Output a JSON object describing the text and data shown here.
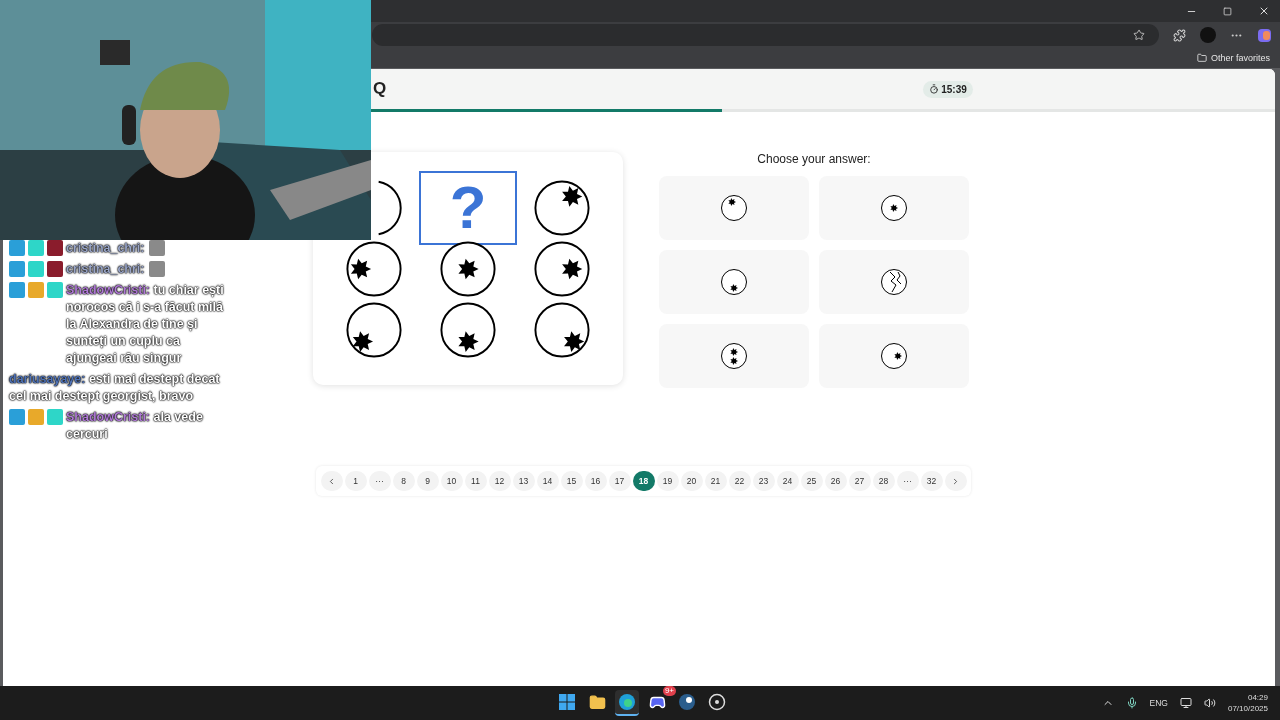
{
  "browser": {
    "bookmark": "Other favorites"
  },
  "header": {
    "title": "Q",
    "timer": "15:39",
    "progress": {
      "level": 0.565
    }
  },
  "puzzle": {
    "cells": [
      {
        "kind": "covered"
      },
      {
        "kind": "question",
        "label": "?"
      },
      {
        "kind": "northeast"
      },
      {
        "kind": "west"
      },
      {
        "kind": "center"
      },
      {
        "kind": "east"
      },
      {
        "kind": "southwest"
      },
      {
        "kind": "south"
      },
      {
        "kind": "southeast"
      }
    ]
  },
  "answers": {
    "prompt": "Choose your answer:",
    "options": [
      {
        "kind": "north",
        "selected": false
      },
      {
        "kind": "center",
        "selected": false
      },
      {
        "kind": "south",
        "selected": false
      },
      {
        "kind": "cracked",
        "selected": false
      },
      {
        "kind": "double",
        "selected": false
      },
      {
        "kind": "east",
        "selected": false
      }
    ]
  },
  "pagination": [
    {
      "kind": "prev",
      "selected": false
    },
    {
      "kind": "page",
      "label": "1",
      "selected": false
    },
    {
      "kind": "ellipsis",
      "label": "···",
      "selected": false
    },
    {
      "kind": "page",
      "label": "8",
      "selected": false
    },
    {
      "kind": "page",
      "label": "9",
      "selected": false
    },
    {
      "kind": "page",
      "label": "10",
      "selected": false
    },
    {
      "kind": "page",
      "label": "11",
      "selected": false
    },
    {
      "kind": "page",
      "label": "12",
      "selected": false
    },
    {
      "kind": "page",
      "label": "13",
      "selected": false
    },
    {
      "kind": "page",
      "label": "14",
      "selected": false
    },
    {
      "kind": "page",
      "label": "15",
      "selected": false
    },
    {
      "kind": "page",
      "label": "16",
      "selected": false
    },
    {
      "kind": "page",
      "label": "17",
      "selected": false
    },
    {
      "kind": "page",
      "label": "18",
      "selected": true
    },
    {
      "kind": "page",
      "label": "19",
      "selected": false
    },
    {
      "kind": "page",
      "label": "20",
      "selected": false
    },
    {
      "kind": "page",
      "label": "21",
      "selected": false
    },
    {
      "kind": "page",
      "label": "22",
      "selected": false
    },
    {
      "kind": "page",
      "label": "23",
      "selected": false
    },
    {
      "kind": "page",
      "label": "24",
      "selected": false
    },
    {
      "kind": "page",
      "label": "25",
      "selected": false
    },
    {
      "kind": "page",
      "label": "26",
      "selected": false
    },
    {
      "kind": "page",
      "label": "27",
      "selected": false
    },
    {
      "kind": "page",
      "label": "28",
      "selected": false
    },
    {
      "kind": "ellipsis",
      "label": "···",
      "selected": false
    },
    {
      "kind": "page",
      "label": "32",
      "selected": false
    },
    {
      "kind": "next",
      "selected": false
    }
  ],
  "chat": [
    {
      "badges": [
        {
          "kind": "tool"
        },
        {
          "kind": "tag"
        },
        {
          "kind": "demon"
        }
      ],
      "name": "cristina_chri:",
      "color": "#9aa6c8",
      "trailing_badges": [
        {
          "kind": "avatar"
        }
      ]
    },
    {
      "badges": [
        {
          "kind": "tool"
        },
        {
          "kind": "tag"
        },
        {
          "kind": "demon"
        }
      ],
      "name": "cristina_chri:",
      "color": "#9aa6c8",
      "trailing_badges": [
        {
          "kind": "avatar"
        }
      ]
    },
    {
      "badges": [
        {
          "kind": "tool"
        },
        {
          "kind": "crown"
        },
        {
          "kind": "tag"
        }
      ],
      "name": "ShadowCristi:",
      "color": "#b07ad6",
      "text": "tu chiar ești norocos că i s-a făcut milă la Alexandra de tine și sunteți un cuplu ca ajungeai rău singur"
    },
    {
      "name": "dariusayaye:",
      "color": "#4f73b8",
      "text": "esti mai destept decat cel mai destept georgist, bravo"
    },
    {
      "badges": [
        {
          "kind": "tool"
        },
        {
          "kind": "crown"
        },
        {
          "kind": "tag"
        }
      ],
      "name": "ShadowCristi:",
      "color": "#b07ad6",
      "text": "ala vede cercuri"
    }
  ],
  "taskbar": {
    "apps": [
      {
        "kind": "start",
        "active": false
      },
      {
        "kind": "folder",
        "active": false
      },
      {
        "kind": "browser",
        "active": true
      },
      {
        "kind": "chat",
        "active": false,
        "badge": "9+"
      },
      {
        "kind": "steam",
        "active": false
      },
      {
        "kind": "obs",
        "active": false
      }
    ],
    "language": "ENG",
    "time": "04:29",
    "date": "07/10/2025"
  }
}
